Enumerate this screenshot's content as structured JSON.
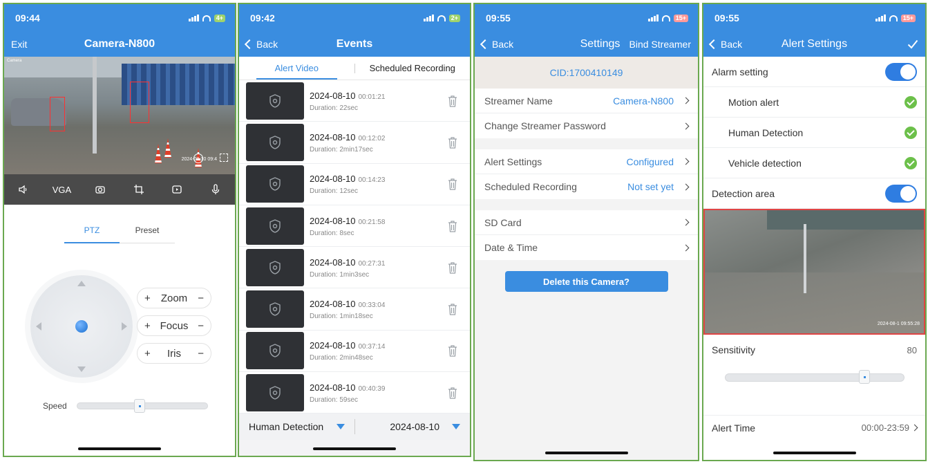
{
  "colors": {
    "accent": "#3a8de0",
    "toggle_on": "#2f7de1",
    "check_green": "#6cc04a",
    "frame_green": "#6aa84f",
    "alert_red": "#e04444"
  },
  "live": {
    "status_time": "09:44",
    "battery": "4+",
    "exit_label": "Exit",
    "title": "Camera-N800",
    "camera_tag": "Camera",
    "timestamp": "2024-08-10 09:4",
    "controls": {
      "speaker_icon": "speaker-icon",
      "quality_label": "VGA",
      "snapshot_icon": "camera-icon",
      "crop_icon": "crop-icon",
      "record_icon": "record-icon",
      "mic_icon": "microphone-icon"
    },
    "tabs": [
      "PTZ",
      "Preset"
    ],
    "pills": [
      {
        "plus": "+",
        "label": "Zoom",
        "minus": "−"
      },
      {
        "plus": "+",
        "label": "Focus",
        "minus": "−"
      },
      {
        "plus": "+",
        "label": "Iris",
        "minus": "−"
      }
    ],
    "speed_label": "Speed",
    "speed_value": 0.48
  },
  "events": {
    "status_time": "09:42",
    "battery": "2+",
    "back_label": "Back",
    "title": "Events",
    "tabs": [
      "Alert Video",
      "Scheduled Recording"
    ],
    "duration_prefix": "Duration:",
    "items": [
      {
        "date": "2024-08-10",
        "time": "00:01:21",
        "duration": "22sec"
      },
      {
        "date": "2024-08-10",
        "time": "00:12:02",
        "duration": "2min17sec"
      },
      {
        "date": "2024-08-10",
        "time": "00:14:23",
        "duration": "12sec"
      },
      {
        "date": "2024-08-10",
        "time": "00:21:58",
        "duration": "8sec"
      },
      {
        "date": "2024-08-10",
        "time": "00:27:31",
        "duration": "1min3sec"
      },
      {
        "date": "2024-08-10",
        "time": "00:33:04",
        "duration": "1min18sec"
      },
      {
        "date": "2024-08-10",
        "time": "00:37:14",
        "duration": "2min48sec"
      },
      {
        "date": "2024-08-10",
        "time": "00:40:39",
        "duration": "59sec"
      }
    ],
    "filter_type": "Human Detection",
    "filter_date": "2024-08-10"
  },
  "settings": {
    "status_time": "09:55",
    "battery": "15+",
    "back_label": "Back",
    "title": "Settings",
    "bind_label": "Bind Streamer",
    "cid": "CID:1700410149",
    "streamer_name_label": "Streamer Name",
    "streamer_name_value": "Camera-N800",
    "change_password_label": "Change Streamer Password",
    "alert_settings_label": "Alert Settings",
    "alert_settings_value": "Configured",
    "scheduled_label": "Scheduled Recording",
    "scheduled_value": "Not set yet",
    "sd_card_label": "SD Card",
    "date_time_label": "Date & Time",
    "delete_label": "Delete this Camera?"
  },
  "alerts": {
    "status_time": "09:55",
    "battery": "15+",
    "back_label": "Back",
    "title": "Alert Settings",
    "confirm_icon": "checkmark-icon",
    "alarm_label": "Alarm setting",
    "motion_label": "Motion alert",
    "human_label": "Human Detection",
    "vehicle_label": "Vehicle detection",
    "area_label": "Detection area",
    "area_timestamp": "2024-08-1 09:55:28",
    "sensitivity_label": "Sensitivity",
    "sensitivity_value": "80",
    "sensitivity_level": 0.8,
    "alert_time_label": "Alert Time",
    "alert_time_value": "00:00-23:59"
  }
}
